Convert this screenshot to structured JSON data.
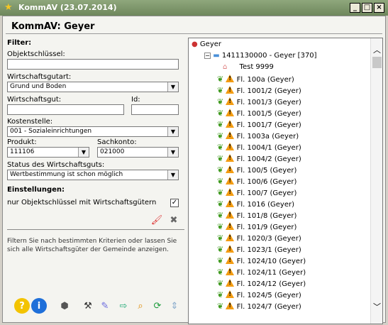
{
  "window": {
    "title": "KommAV (23.07.2014)"
  },
  "header": {
    "title": "KommAV: Geyer"
  },
  "filter": {
    "heading": "Filter:",
    "objektschluessel_label": "Objektschlüssel:",
    "objektschluessel_value": "",
    "wirtschaftsgutart_label": "Wirtschaftsgutart:",
    "wirtschaftsgutart_value": "Grund und Boden",
    "wirtschaftsgut_label": "Wirtschaftsgut:",
    "id_label": "Id:",
    "kostenstelle_label": "Kostenstelle:",
    "kostenstelle_value": "001 - Sozialeinrichtungen",
    "produkt_label": "Produkt:",
    "produkt_value": "111106",
    "sachkonto_label": "Sachkonto:",
    "sachkonto_value": "021000",
    "status_label": "Status des Wirtschaftsguts:",
    "status_value": "Wertbestimmung ist schon möglich"
  },
  "settings": {
    "heading": "Einstellungen:",
    "only_with_label": "nur Objektschlüssel mit Wirtschaftsgütern",
    "only_with_checked": "✓"
  },
  "info_text": "Filtern Sie nach bestimmten Kriterien oder lassen Sie sich alle Wirtschaftsgüter der Gemeinde anzeigen.",
  "tree": {
    "root": "Geyer",
    "node": "1411130000 - Geyer [370]",
    "house_item": "Test 9999",
    "items": [
      "Fl. 100a (Geyer)",
      "Fl. 1001/2 (Geyer)",
      "Fl. 1001/3 (Geyer)",
      "Fl. 1001/5 (Geyer)",
      "Fl. 1001/7 (Geyer)",
      "Fl. 1003a (Geyer)",
      "Fl. 1004/1 (Geyer)",
      "Fl. 1004/2 (Geyer)",
      "Fl. 100/5 (Geyer)",
      "Fl. 100/6 (Geyer)",
      "Fl. 100/7 (Geyer)",
      "Fl. 1016 (Geyer)",
      "Fl. 101/8 (Geyer)",
      "Fl. 101/9 (Geyer)",
      "Fl. 1020/3 (Geyer)",
      "Fl. 1023/1 (Geyer)",
      "Fl. 1024/10 (Geyer)",
      "Fl. 1024/11 (Geyer)",
      "Fl. 1024/12 (Geyer)",
      "Fl. 1024/5 (Geyer)",
      "Fl. 1024/7 (Geyer)"
    ]
  },
  "colors": {
    "titlebar": "#7a9367",
    "warn": "#f39c12",
    "leaf": "#3f9a1f",
    "folder": "#4a90d9"
  }
}
